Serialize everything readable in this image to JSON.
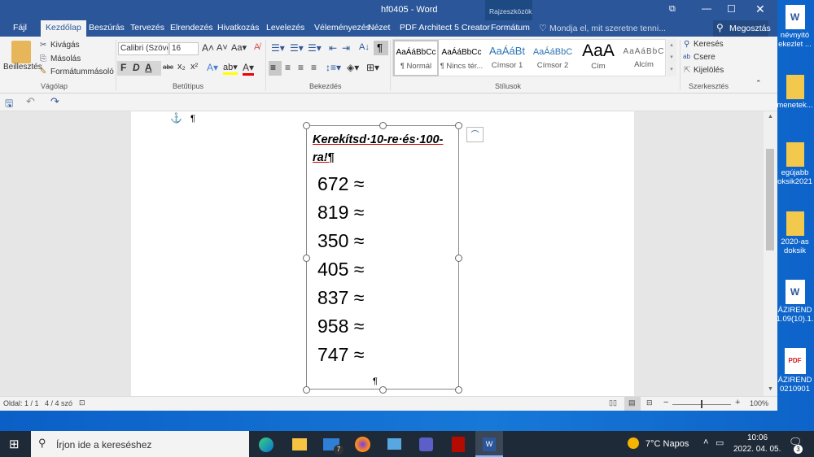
{
  "window": {
    "title": "hf0405 - Word",
    "context_group": "Rajzeszközök",
    "share": "Megosztás",
    "tell_me": "Mondja el, mit szeretne tenni..."
  },
  "tabs": [
    "Fájl",
    "Kezdőlap",
    "Beszúrás",
    "Tervezés",
    "Elrendezés",
    "Hivatkozás",
    "Levelezés",
    "Véleményezés",
    "Nézet",
    "PDF Architect 5 Creator",
    "Formátum"
  ],
  "ribbon": {
    "clipboard": {
      "paste": "Beillesztés",
      "cut": "Kivágás",
      "copy": "Másolás",
      "format_painter": "Formátummásoló",
      "group": "Vágólap"
    },
    "font": {
      "name": "Calibri (Szöve",
      "size": "16",
      "group": "Betűtípus",
      "bold": "F",
      "italic": "D",
      "underline": "A"
    },
    "paragraph": {
      "group": "Bekezdés"
    },
    "styles": {
      "items": [
        {
          "preview": "AaÁáBbCc",
          "label": "¶ Normál"
        },
        {
          "preview": "AaÁáBbCc",
          "label": "¶ Nincs tér..."
        },
        {
          "preview": "AaÁáBt",
          "label": "Címsor 1"
        },
        {
          "preview": "AaÁáBbC",
          "label": "Címsor 2"
        },
        {
          "preview": "AaA",
          "label": "Cím"
        },
        {
          "preview": "AaÁáBbC",
          "label": "Alcím"
        }
      ],
      "group": "Stílusok"
    },
    "editing": {
      "find": "Keresés",
      "replace": "Csere",
      "select": "Kijelölés",
      "group": "Szerkesztés"
    }
  },
  "document": {
    "title": "Kerekítsd·10-re·és·100-ra!¶",
    "numbers": [
      "672 ≈",
      "819 ≈",
      "350 ≈",
      "405 ≈",
      "837 ≈",
      "958 ≈",
      "747 ≈"
    ],
    "pilcrow": "¶"
  },
  "status": {
    "page": "Oldal: 1 / 1",
    "words": "4 / 4 szó",
    "zoom": "100%"
  },
  "taskbar": {
    "search_placeholder": "Írjon ide a kereséshez",
    "weather": "7°C  Napos",
    "time": "10:06",
    "date": "2022. 04. 05.",
    "mail_badge": "7",
    "notif_badge": "3"
  },
  "desktop_icons": [
    {
      "label": "névnyitó ekezlet ..."
    },
    {
      "label": "menetek..."
    },
    {
      "label": "egújabb oksik2021"
    },
    {
      "label": "2020-as doksik"
    },
    {
      "label": "ÁZIREND 1.09(10).1."
    },
    {
      "label": "ÁZIREND 0210901"
    }
  ]
}
